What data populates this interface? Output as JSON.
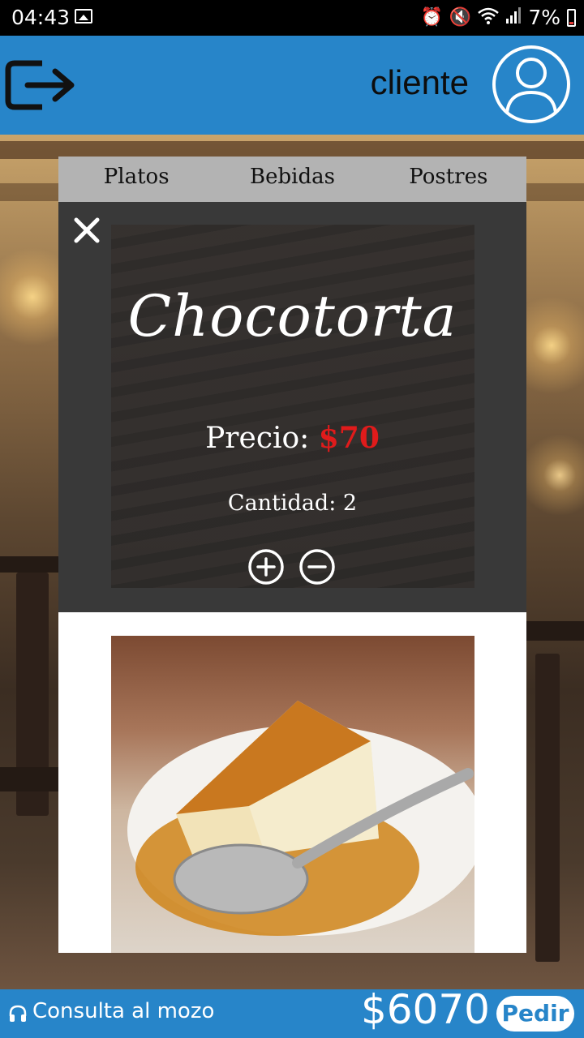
{
  "status_bar": {
    "time": "04:43",
    "battery": "7%"
  },
  "header": {
    "user_label": "cliente"
  },
  "tabs": [
    {
      "label": "Platos"
    },
    {
      "label": "Bebidas"
    },
    {
      "label": "Postres"
    }
  ],
  "product": {
    "name": "Chocotorta",
    "price_label": "Precio:",
    "price_value": "$70",
    "quantity_text": "Cantidad: 2"
  },
  "footer": {
    "consulta_label": "Consulta al mozo",
    "total": "$6070",
    "order_button": "Pedir"
  },
  "colors": {
    "primary": "#2785c9",
    "card": "#393939",
    "price": "#e01b1b",
    "tabs_bg": "#b3b3b3"
  }
}
